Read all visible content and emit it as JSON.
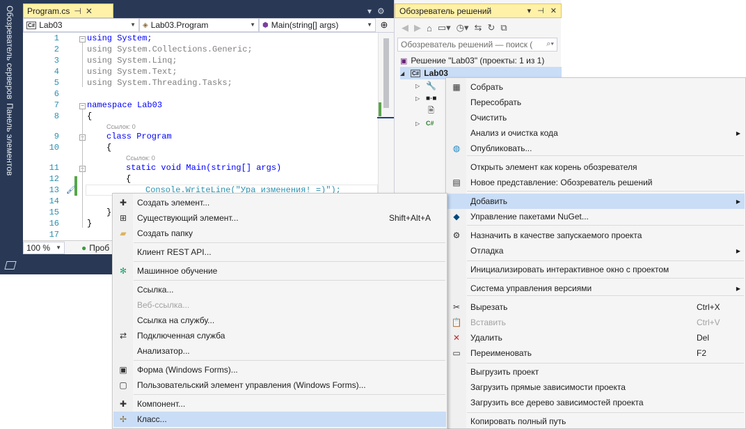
{
  "left_strip": {
    "server_explorer": "Обозреватель серверов",
    "toolbox": "Панель элементов"
  },
  "editor": {
    "tab_title": "Program.cs",
    "nav": {
      "project": "Lab03",
      "class": "Lab03.Program",
      "member": "Main(string[] args)"
    },
    "lines": [
      {
        "n": "1",
        "code": "using System;"
      },
      {
        "n": "2",
        "code": "using System.Collections.Generic;"
      },
      {
        "n": "3",
        "code": "using System.Linq;"
      },
      {
        "n": "4",
        "code": "using System.Text;"
      },
      {
        "n": "5",
        "code": "using System.Threading.Tasks;"
      },
      {
        "n": "6",
        "code": ""
      },
      {
        "n": "7",
        "code": "namespace Lab03"
      },
      {
        "n": "8",
        "code": "{"
      },
      {
        "n": "9",
        "code": "class Program"
      },
      {
        "n": "10",
        "code": "{"
      },
      {
        "n": "11",
        "code": "static void Main(string[] args)"
      },
      {
        "n": "12",
        "code": "{"
      },
      {
        "n": "13",
        "code": "Console.WriteLine(\"Ура изменения! =)\");"
      },
      {
        "n": "14",
        "code": ""
      },
      {
        "n": "15",
        "code": "}"
      },
      {
        "n": "16",
        "code": "}"
      },
      {
        "n": "17",
        "code": ""
      }
    ],
    "refs_hint_1": "Ссылок: 0",
    "refs_hint_2": "Ссылок: 0",
    "zoom": "100 %",
    "status_text": "Проб"
  },
  "solution_explorer": {
    "title": "Обозреватель решений",
    "search_placeholder": "Обозреватель решений — поиск (",
    "solution_label": "Решение \"Lab03\" (проекты: 1 из 1)",
    "project_label": "Lab03"
  },
  "project_menu": {
    "items": [
      {
        "label": "Собрать",
        "shortcut": "",
        "icon": "build-icon"
      },
      {
        "label": "Пересобрать",
        "shortcut": "",
        "icon": ""
      },
      {
        "label": "Очистить",
        "shortcut": "",
        "icon": ""
      },
      {
        "label": "Анализ и очистка кода",
        "shortcut": "",
        "icon": "",
        "submenu": true
      },
      {
        "label": "Опубликовать...",
        "shortcut": "",
        "icon": "publish-icon"
      },
      {
        "label": "Открыть элемент как корень обозревателя",
        "shortcut": "",
        "icon": ""
      },
      {
        "label": "Новое представление: Обозреватель решений",
        "shortcut": "",
        "icon": "new-view-icon"
      },
      {
        "label": "Добавить",
        "shortcut": "",
        "icon": "",
        "submenu": true,
        "highlight": true
      },
      {
        "label": "Управление пакетами NuGet...",
        "shortcut": "",
        "icon": "nuget-icon"
      },
      {
        "label": "Назначить в качестве запускаемого проекта",
        "shortcut": "",
        "icon": "gear-icon"
      },
      {
        "label": "Отладка",
        "shortcut": "",
        "icon": "",
        "submenu": true
      },
      {
        "label": "Инициализировать интерактивное окно с проектом",
        "shortcut": "",
        "icon": ""
      },
      {
        "label": "Система управления версиями",
        "shortcut": "",
        "icon": "",
        "submenu": true
      },
      {
        "label": "Вырезать",
        "shortcut": "Ctrl+X",
        "icon": "cut-icon"
      },
      {
        "label": "Вставить",
        "shortcut": "Ctrl+V",
        "icon": "paste-icon",
        "disabled": true
      },
      {
        "label": "Удалить",
        "shortcut": "Del",
        "icon": "delete-icon"
      },
      {
        "label": "Переименовать",
        "shortcut": "F2",
        "icon": "rename-icon"
      },
      {
        "label": "Выгрузить проект",
        "shortcut": "",
        "icon": ""
      },
      {
        "label": "Загрузить прямые зависимости проекта",
        "shortcut": "",
        "icon": ""
      },
      {
        "label": "Загрузить все дерево зависимостей проекта",
        "shortcut": "",
        "icon": ""
      },
      {
        "label": "Копировать полный путь",
        "shortcut": "",
        "icon": ""
      }
    ]
  },
  "add_menu": {
    "items": [
      {
        "label": "Создать элемент...",
        "shortcut": "",
        "icon": "new-item-icon"
      },
      {
        "label": "Существующий элемент...",
        "shortcut": "Shift+Alt+A",
        "icon": "existing-item-icon"
      },
      {
        "label": "Создать папку",
        "shortcut": "",
        "icon": "folder-icon"
      },
      {
        "label": "Клиент REST API...",
        "shortcut": "",
        "icon": ""
      },
      {
        "label": "Машинное обучение",
        "shortcut": "",
        "icon": "ml-icon"
      },
      {
        "label": "Ссылка...",
        "shortcut": "",
        "icon": ""
      },
      {
        "label": "Веб-ссылка...",
        "shortcut": "",
        "icon": "",
        "disabled": true
      },
      {
        "label": "Ссылка на службу...",
        "shortcut": "",
        "icon": ""
      },
      {
        "label": "Подключенная служба",
        "shortcut": "",
        "icon": "connected-service-icon"
      },
      {
        "label": "Анализатор...",
        "shortcut": "",
        "icon": ""
      },
      {
        "label": "Форма (Windows Forms)...",
        "shortcut": "",
        "icon": "form-icon"
      },
      {
        "label": "Пользовательский элемент управления (Windows Forms)...",
        "shortcut": "",
        "icon": "user-control-icon"
      },
      {
        "label": "Компонент...",
        "shortcut": "",
        "icon": "component-icon"
      },
      {
        "label": "Класс...",
        "shortcut": "",
        "icon": "class-icon",
        "highlight": true
      }
    ]
  }
}
